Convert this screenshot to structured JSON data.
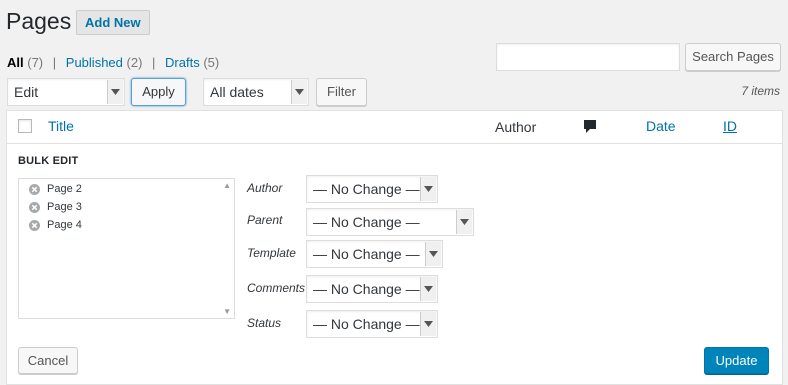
{
  "header": {
    "title": "Pages",
    "add_new": "Add New"
  },
  "views": {
    "all": "All",
    "all_count": "(7)",
    "published": "Published",
    "published_count": "(2)",
    "drafts": "Drafts",
    "drafts_count": "(5)",
    "separator": "|"
  },
  "search": {
    "value": "",
    "button": "Search Pages"
  },
  "tablenav": {
    "bulk_action": "Edit",
    "apply": "Apply",
    "dates": "All dates",
    "filter": "Filter",
    "items": "7 items"
  },
  "columns": {
    "title": "Title",
    "author": "Author",
    "comments_icon": "comment-bubble-icon",
    "date": "Date",
    "id": "ID"
  },
  "bulk_edit": {
    "heading": "BULK EDIT",
    "items": [
      "Page 2",
      "Page 3",
      "Page 4"
    ],
    "fields": [
      {
        "label": "Author",
        "value": "— No Change —"
      },
      {
        "label": "Parent",
        "value": "— No Change —"
      },
      {
        "label": "Template",
        "value": "— No Change —"
      },
      {
        "label": "Comments",
        "value": "— No Change —"
      },
      {
        "label": "Status",
        "value": "— No Change —"
      }
    ],
    "cancel": "Cancel",
    "update": "Update"
  },
  "colors": {
    "link": "#0073aa",
    "primary": "#0085ba",
    "background": "#f1f1f1"
  }
}
